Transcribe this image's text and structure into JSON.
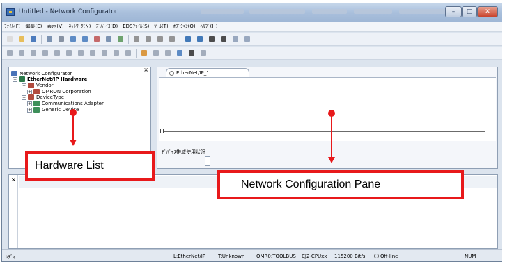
{
  "window": {
    "title": "Untitled - Network Configurator",
    "buttons": {
      "minimize": "–",
      "maximize": "□",
      "close": "✕"
    }
  },
  "menu": {
    "items": [
      "ﾌｧｲﾙ(F)",
      "編集(E)",
      "表示(V)",
      "ﾈｯﾄﾜｰｸ(N)",
      "ﾃﾞﾊﾞｲｽ(D)",
      "EDSﾌｧｲﾙ(S)",
      "ﾂｰﾙ(T)",
      "ｵﾌﾟｼｮﾝ(O)",
      "ﾍﾙﾌﾟ(H)"
    ]
  },
  "toolbar1": {
    "icons": [
      "new-icon",
      "open-icon",
      "save-icon",
      "separator",
      "properties-icon",
      "print-icon",
      "upload-icon",
      "download-icon",
      "compare-icon",
      "monitor-icon",
      "online-icon",
      "separator",
      "cut-icon",
      "copy-icon",
      "paste-icon",
      "delete-icon",
      "separator",
      "register-icon",
      "parameter-icon",
      "table-icon",
      "grid-icon",
      "undo-icon",
      "redo-icon"
    ],
    "colors": [
      "#d9d9d9",
      "#e6b84a",
      "#3b6fb6",
      "",
      "#6f88aa",
      "#7b8799",
      "#4d7fbf",
      "#4d7fbf",
      "#c05a5a",
      "#6f88aa",
      "#5f9a5f",
      "",
      "#8a8a8a",
      "#8a8a8a",
      "#8a8a8a",
      "#8a8a8a",
      "",
      "#2f6bb0",
      "#2f6bb0",
      "#3a3a3a",
      "#3a3a3a",
      "#8fa0b8",
      "#8fa0b8"
    ]
  },
  "toolbar2": {
    "icons": [
      "settings-icon",
      "io-icon",
      "edit-icon",
      "edit2-icon",
      "arrow-up-icon",
      "arrow-down-icon",
      "check-icon",
      "monitor2-icon",
      "zoom-icon",
      "list-icon",
      "graph-icon",
      "separator",
      "map-icon",
      "alarm-icon",
      "report-icon",
      "window-icon",
      "find-icon",
      "help-icon"
    ],
    "colors": [
      "#9aa5b5",
      "#9aa5b5",
      "#9aa5b5",
      "#9aa5b5",
      "#9aa5b5",
      "#9aa5b5",
      "#9aa5b5",
      "#9aa5b5",
      "#9aa5b5",
      "#9aa5b5",
      "#9aa5b5",
      "",
      "#d78f2f",
      "#9aa5b5",
      "#9aa5b5",
      "#4d7fbf",
      "#3a3a3a",
      "#9aa5b5"
    ]
  },
  "tree": {
    "close_label": "×",
    "items": [
      {
        "label": "Network Configurator",
        "icon": "network-icon",
        "bold": false,
        "expander": ""
      },
      {
        "label": "EtherNet/IP Hardware",
        "icon": "hardware-icon",
        "bold": true,
        "expander": "−"
      },
      {
        "label": "Vendor",
        "icon": "folder-icon",
        "bold": false,
        "expander": "−"
      },
      {
        "label": "OMRON Corporation",
        "icon": "folder-icon",
        "bold": false,
        "expander": "+"
      },
      {
        "label": "DeviceType",
        "icon": "folder-icon",
        "bold": false,
        "expander": "−"
      },
      {
        "label": "Communications Adapter",
        "icon": "device-icon",
        "bold": false,
        "expander": "+"
      },
      {
        "label": "Generic Device",
        "icon": "device-icon",
        "bold": false,
        "expander": "+"
      }
    ]
  },
  "config": {
    "tab_label": "EtherNet/IP_1",
    "usage_label": "ﾃﾞﾊﾞｲｽ帯域使用状況"
  },
  "output": {
    "close_label": "×"
  },
  "status": {
    "left": "ﾚﾃﾞｨ",
    "network": "L:EtherNet/IP",
    "target": "T:Unknown",
    "port": "OMR0:TOOLBUS",
    "plc": "CJ2-CPUxx",
    "baud": "115200 Bit/s",
    "mode": "Off-line",
    "numlock": "NUM"
  },
  "annotations": {
    "hardware_list": "Hardware List",
    "network_pane": "Network Configuration Pane",
    "color": "#e8191b"
  }
}
